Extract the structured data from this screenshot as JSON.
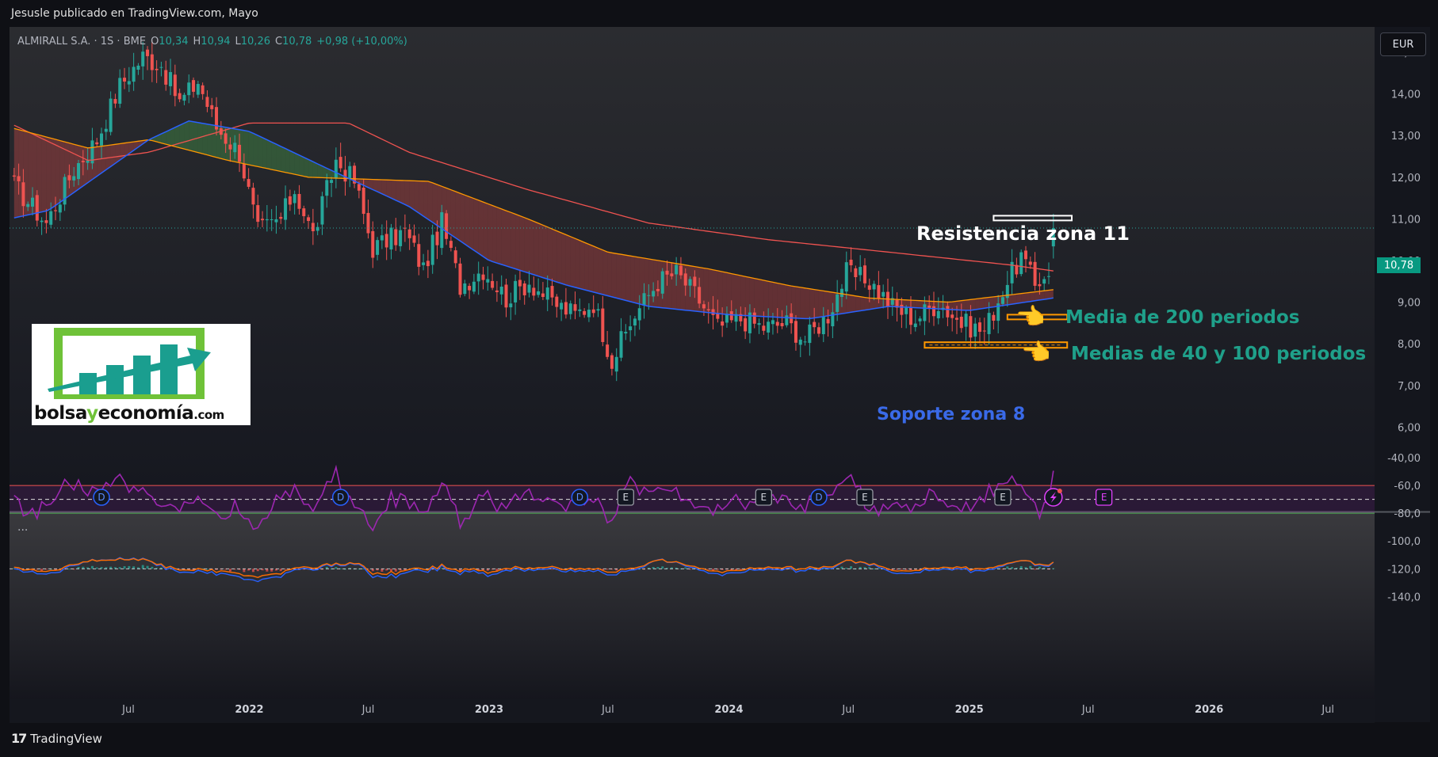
{
  "header": {
    "publisher_text": "Jesusle publicado en TradingView.com, Mayo"
  },
  "legend": {
    "symbol": "ALMIRALL S.A. · 1S · BME",
    "open_label": "O",
    "open": "10,34",
    "high_label": "H",
    "high": "10,94",
    "low_label": "L",
    "low": "10,26",
    "close_label": "C",
    "close": "10,78",
    "change": "+0,98 (+10,00%)"
  },
  "currency_button": "EUR",
  "price_tag": "10,78",
  "rsi_menu": "...",
  "footer": {
    "brand": "TradingView"
  },
  "logo": {
    "part1": "bolsa",
    "part2": "y",
    "part3": "economía",
    "part4": ".com"
  },
  "annotations": {
    "resistance": "Resistencia zona 11",
    "ma200": "Media de 200 periodos",
    "ma40_100": "Medias de 40 y 100 periodos",
    "support": "Soporte zona 8"
  },
  "colors": {
    "up": "#26a69a",
    "down": "#ef5350",
    "ma200": "#f05350",
    "ma40": "#2962ff",
    "ma100": "#ff9800",
    "rsi": "#9c27b0",
    "annotation_green": "#1fa08a",
    "annotation_blue": "#3a6ae8"
  },
  "icons": [
    "tradingview-logo-icon",
    "pointing-hand-icon",
    "dividend-marker-icon",
    "earnings-marker-icon",
    "flash-icon"
  ],
  "chart_data": {
    "type": "candlestick",
    "timeframe": "1W",
    "y_axis": {
      "ticks": [
        "6,00",
        "7,00",
        "8,00",
        "9,00",
        "10,00",
        "11,00",
        "12,00",
        "13,00",
        "14,00",
        "15,00"
      ],
      "ylim": [
        5.7,
        15.3
      ]
    },
    "x_axis": {
      "ticks": [
        "Jul",
        "2022",
        "Jul",
        "2023",
        "Jul",
        "2024",
        "Jul",
        "2025",
        "Jul",
        "2026",
        "Jul"
      ],
      "start_date": "2021-01-01",
      "end_date": "2026-11-01"
    },
    "price_keypoints": [
      [
        "2021-01-08",
        11.8
      ],
      [
        "2021-02-26",
        10.9
      ],
      [
        "2021-04-09",
        12.2
      ],
      [
        "2021-05-14",
        12.9
      ],
      [
        "2021-06-18",
        14.2
      ],
      [
        "2021-07-23",
        14.9
      ],
      [
        "2021-08-20",
        14.7
      ],
      [
        "2021-09-17",
        13.8
      ],
      [
        "2021-10-15",
        14.3
      ],
      [
        "2021-11-12",
        13.2
      ],
      [
        "2021-12-17",
        12.6
      ],
      [
        "2022-01-14",
        10.7
      ],
      [
        "2022-02-18",
        11.0
      ],
      [
        "2022-03-11",
        11.7
      ],
      [
        "2022-04-08",
        10.6
      ],
      [
        "2022-05-13",
        12.4
      ],
      [
        "2022-06-10",
        11.9
      ],
      [
        "2022-07-08",
        10.3
      ],
      [
        "2022-08-26",
        10.7
      ],
      [
        "2022-09-23",
        9.8
      ],
      [
        "2022-10-21",
        10.9
      ],
      [
        "2022-11-18",
        9.4
      ],
      [
        "2022-12-23",
        9.8
      ],
      [
        "2023-01-27",
        9.1
      ],
      [
        "2023-03-03",
        9.5
      ],
      [
        "2023-04-07",
        9.0
      ],
      [
        "2023-05-12",
        8.7
      ],
      [
        "2023-06-09",
        9.0
      ],
      [
        "2023-07-07",
        7.6
      ],
      [
        "2023-08-11",
        8.7
      ],
      [
        "2023-09-15",
        9.5
      ],
      [
        "2023-10-13",
        9.7
      ],
      [
        "2023-11-10",
        9.2
      ],
      [
        "2023-12-15",
        8.4
      ],
      [
        "2024-01-19",
        8.6
      ],
      [
        "2024-02-23",
        8.4
      ],
      [
        "2024-03-29",
        8.5
      ],
      [
        "2024-04-26",
        8.1
      ],
      [
        "2024-05-31",
        8.7
      ],
      [
        "2024-06-28",
        9.7
      ],
      [
        "2024-08-02",
        9.5
      ],
      [
        "2024-09-06",
        8.9
      ],
      [
        "2024-10-11",
        8.6
      ],
      [
        "2024-11-15",
        9.0
      ],
      [
        "2024-12-20",
        8.5
      ],
      [
        "2025-01-24",
        8.3
      ],
      [
        "2025-02-21",
        9.3
      ],
      [
        "2025-03-21",
        10.1
      ],
      [
        "2025-04-11",
        9.4
      ],
      [
        "2025-05-02",
        9.8
      ],
      [
        "2025-05-09",
        10.78
      ]
    ],
    "ma200_keypoints": [
      [
        "2021-01-01",
        13.3
      ],
      [
        "2021-05-01",
        12.4
      ],
      [
        "2021-08-01",
        12.6
      ],
      [
        "2022-01-01",
        13.3
      ],
      [
        "2022-06-01",
        13.3
      ],
      [
        "2022-09-01",
        12.6
      ],
      [
        "2023-03-01",
        11.7
      ],
      [
        "2023-09-01",
        10.9
      ],
      [
        "2024-03-01",
        10.5
      ],
      [
        "2024-09-01",
        10.2
      ],
      [
        "2025-03-01",
        9.9
      ],
      [
        "2025-05-09",
        9.75
      ]
    ],
    "ma100_keypoints": [
      [
        "2021-01-01",
        13.2
      ],
      [
        "2021-05-01",
        12.7
      ],
      [
        "2021-08-01",
        12.9
      ],
      [
        "2021-12-01",
        12.4
      ],
      [
        "2022-04-01",
        12.0
      ],
      [
        "2022-10-01",
        11.9
      ],
      [
        "2023-03-01",
        11.0
      ],
      [
        "2023-07-01",
        10.2
      ],
      [
        "2023-12-01",
        9.8
      ],
      [
        "2024-04-01",
        9.4
      ],
      [
        "2024-08-01",
        9.1
      ],
      [
        "2024-12-01",
        9.0
      ],
      [
        "2025-05-09",
        9.3
      ]
    ],
    "ma40_keypoints": [
      [
        "2021-01-01",
        11.0
      ],
      [
        "2021-03-01",
        11.2
      ],
      [
        "2021-08-01",
        12.9
      ],
      [
        "2021-10-01",
        13.35
      ],
      [
        "2022-01-01",
        13.1
      ],
      [
        "2022-05-01",
        12.2
      ],
      [
        "2022-09-01",
        11.3
      ],
      [
        "2023-01-01",
        10.0
      ],
      [
        "2023-05-01",
        9.4
      ],
      [
        "2023-09-01",
        8.9
      ],
      [
        "2024-01-01",
        8.7
      ],
      [
        "2024-05-01",
        8.6
      ],
      [
        "2024-09-01",
        8.9
      ],
      [
        "2025-01-01",
        8.8
      ],
      [
        "2025-05-09",
        9.1
      ]
    ],
    "rsi": {
      "ylim": [
        -145,
        -35
      ],
      "ticks": [
        "-40,00",
        "-60,0",
        "-80,0",
        "-100,0",
        "-120,0",
        "-140,0"
      ],
      "upper_band": -60,
      "middle": -70,
      "lower_band": -80
    },
    "macd": {
      "baseline": -120
    },
    "events": [
      {
        "type": "D",
        "date": "2021-05-21"
      },
      {
        "type": "D",
        "date": "2022-05-20"
      },
      {
        "type": "D",
        "date": "2023-05-19"
      },
      {
        "type": "E",
        "date": "2023-07-28"
      },
      {
        "type": "E",
        "date": "2024-02-23"
      },
      {
        "type": "D",
        "date": "2024-05-17"
      },
      {
        "type": "E",
        "date": "2024-07-26"
      },
      {
        "type": "E",
        "date": "2025-02-21"
      },
      {
        "type": "flash",
        "date": "2025-05-09"
      },
      {
        "type": "E",
        "date": "2025-07-25"
      }
    ],
    "zones": {
      "resistance": 11,
      "support": 8
    },
    "last_price": 10.78
  }
}
